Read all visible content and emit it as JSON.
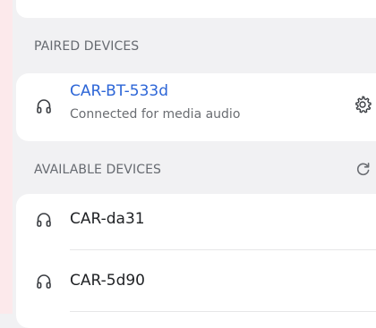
{
  "sections": {
    "paired": {
      "header": "PAIRED DEVICES",
      "devices": [
        {
          "name": "CAR-BT-533d",
          "status": "Connected for media audio",
          "icon": "headphones-icon",
          "settings_icon": "gear-icon"
        }
      ]
    },
    "available": {
      "header": "AVAILABLE DEVICES",
      "refresh_icon": "refresh-icon",
      "devices": [
        {
          "name": "CAR-da31",
          "icon": "headphones-icon"
        },
        {
          "name": "CAR-5d90",
          "icon": "headphones-icon"
        }
      ]
    }
  },
  "colors": {
    "accent": "#2d66d7",
    "header_text": "#666a70",
    "background": "#f1f1f3",
    "card": "#ffffff"
  }
}
